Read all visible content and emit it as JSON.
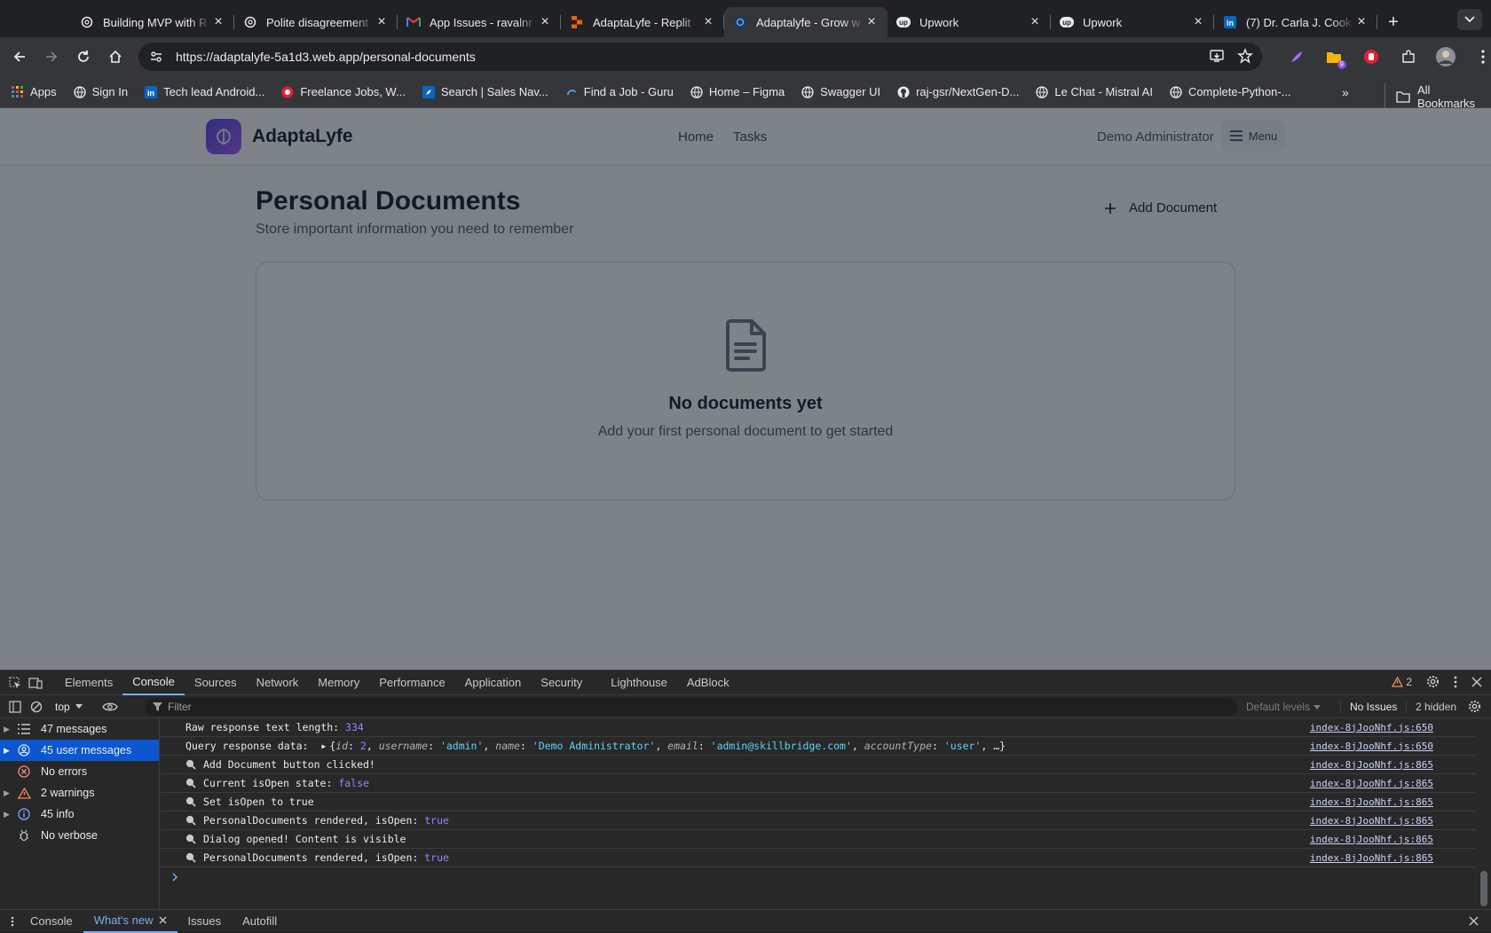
{
  "browser": {
    "tabs": [
      {
        "title": "Building MVP with R",
        "icon": "openai-icon"
      },
      {
        "title": "Polite disagreement",
        "icon": "openai-icon"
      },
      {
        "title": "App Issues - ravalnr",
        "icon": "gmail-icon"
      },
      {
        "title": "AdaptaLyfe - Replit",
        "icon": "replit-icon"
      },
      {
        "title": "Adaptalyfe - Grow w",
        "icon": "adaptalyfe-icon",
        "active": true
      },
      {
        "title": "Upwork",
        "icon": "upwork-icon"
      },
      {
        "title": "Upwork",
        "icon": "upwork-icon"
      },
      {
        "title": "(7) Dr. Carla J. Cook",
        "icon": "linkedin-icon"
      }
    ],
    "url": "https://adaptalyfe-5a1d3.web.app/personal-documents",
    "extension_badge": "9",
    "bookmarks": [
      {
        "label": "Apps",
        "icon": "apps-grid-icon"
      },
      {
        "label": "Sign In",
        "icon": "globe-icon"
      },
      {
        "label": "Tech lead Android...",
        "icon": "linkedin-icon"
      },
      {
        "label": "Freelance Jobs, W...",
        "icon": "freelancer-icon"
      },
      {
        "label": "Search | Sales Nav...",
        "icon": "compass-icon"
      },
      {
        "label": "Find a Job - Guru",
        "icon": "guru-icon"
      },
      {
        "label": "Home – Figma",
        "icon": "globe-icon"
      },
      {
        "label": "Swagger UI",
        "icon": "globe-icon"
      },
      {
        "label": "raj-gsr/NextGen-D...",
        "icon": "github-icon"
      },
      {
        "label": "Le Chat - Mistral AI",
        "icon": "globe-icon"
      },
      {
        "label": "Complete-Python-...",
        "icon": "globe-icon"
      }
    ],
    "bookmarks_more": "»",
    "all_bookmarks": "All Bookmarks"
  },
  "app": {
    "brand": "AdaptaLyfe",
    "nav": [
      "Home",
      "Tasks"
    ],
    "user": "Demo Administrator",
    "menu_label": "Menu",
    "page_title": "Personal Documents",
    "page_subtitle": "Store important information you need to remember",
    "add_button": "Add Document",
    "empty_title": "No documents yet",
    "empty_desc": "Add your first personal document to get started"
  },
  "devtools": {
    "tabs": [
      "Elements",
      "Console",
      "Sources",
      "Network",
      "Memory",
      "Performance",
      "Application",
      "Security",
      "Lighthouse",
      "AdBlock"
    ],
    "active_tab": "Console",
    "warning_count": "2",
    "context": "top",
    "filter_placeholder": "Filter",
    "levels": "Default levels",
    "issues": "No Issues",
    "hidden": "2 hidden",
    "sidebar": [
      {
        "label": "47 messages",
        "icon": "list-icon"
      },
      {
        "label": "45 user messages",
        "icon": "user-icon",
        "selected": true
      },
      {
        "label": "No errors",
        "icon": "error-icon"
      },
      {
        "label": "2 warnings",
        "icon": "warning-icon"
      },
      {
        "label": "45 info",
        "icon": "info-icon"
      },
      {
        "label": "No verbose",
        "icon": "bug-icon"
      }
    ],
    "logs": [
      {
        "prefix": "Raw response text length: ",
        "value": "334",
        "source": "index-8jJooNhf.js:650"
      },
      {
        "prefix": "Query response data: ",
        "object": {
          "open": "{",
          "k1": "id",
          "v1": "2",
          "k2": "username",
          "v2": "'admin'",
          "k3": "name",
          "v3": "'Demo Administrator'",
          "k4": "email",
          "v4": "'admin@skillbridge.com'",
          "k5": "accountType",
          "v5": "'user'",
          "close": ", …}"
        },
        "source": "index-8jJooNhf.js:650"
      },
      {
        "text": "Add Document button clicked!",
        "source": "index-8jJooNhf.js:865"
      },
      {
        "prefix": "Current isOpen state: ",
        "value": "false",
        "source": "index-8jJooNhf.js:865"
      },
      {
        "text": "Set isOpen to true",
        "source": "index-8jJooNhf.js:865"
      },
      {
        "prefix": "PersonalDocuments rendered, isOpen: ",
        "value": "true",
        "source": "index-8jJooNhf.js:865"
      },
      {
        "text": "Dialog opened! Content is visible",
        "source": "index-8jJooNhf.js:865"
      },
      {
        "prefix": "PersonalDocuments rendered, isOpen: ",
        "value": "true",
        "source": "index-8jJooNhf.js:865"
      }
    ],
    "drawer_tabs": [
      "Console",
      "What's new",
      "Issues",
      "Autofill"
    ]
  }
}
